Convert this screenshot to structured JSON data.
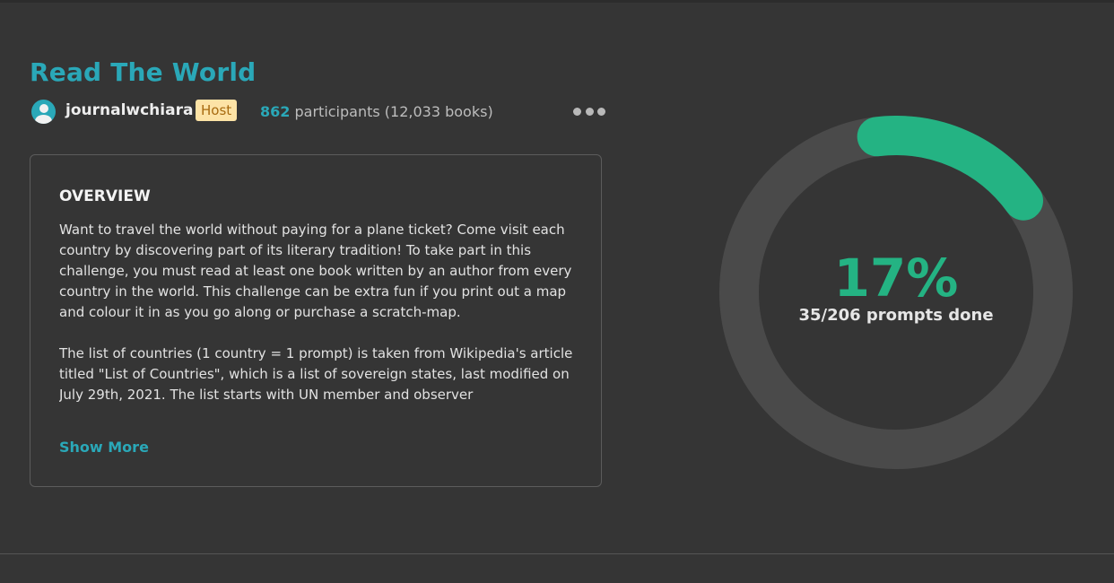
{
  "challenge": {
    "title": "Read The World"
  },
  "host": {
    "username": "journalwchiara",
    "badge": "Host"
  },
  "participants": {
    "count": "862",
    "label": "participants (12,033 books)"
  },
  "overview": {
    "heading": "OVERVIEW",
    "paragraphs": [
      "Want to travel the world without paying for a plane ticket? Come visit each country by discovering part of its literary tradition! To take part in this challenge, you must read at least one book written by an author from every country in the world. This challenge can be extra fun if you print out a map and colour it in as you go along or purchase a scratch-map.",
      "The list of countries (1 country = 1 prompt) is taken from Wikipedia's article titled \"List of Countries\", which is a list of sovereign states, last modified on July 29th, 2021. The list starts with UN member and observer"
    ],
    "show_more_label": "Show More"
  },
  "progress": {
    "percent_label": "17%",
    "fraction": 0.17,
    "prompts_label": "35/206 prompts done"
  },
  "colors": {
    "accent": "#2aa8b8",
    "progress": "#24b383",
    "track": "#4a4a4a",
    "background": "#353535"
  },
  "icons": {
    "avatar": "user-avatar-icon",
    "more": "more-options-icon"
  }
}
